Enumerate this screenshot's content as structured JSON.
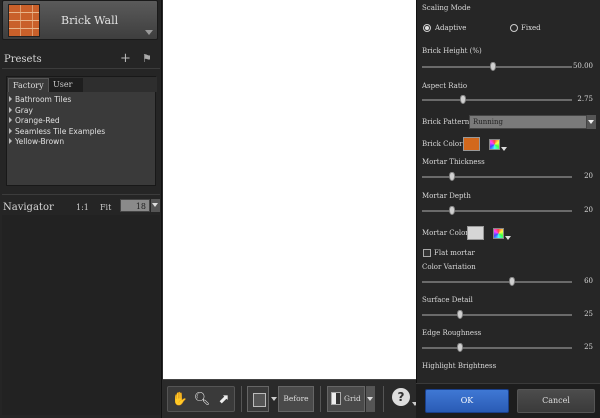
{
  "filter": {
    "name": "Brick Wall"
  },
  "presets": {
    "title": "Presets",
    "tabs": [
      "Factory",
      "User"
    ],
    "items": [
      "Bathroom Tiles",
      "Gray",
      "Orange-Red",
      "Seamless Tile Examples",
      "Yellow-Brown"
    ]
  },
  "navigator": {
    "title": "Navigator",
    "one_to_one": "1:1",
    "fit": "Fit",
    "zoom": "18"
  },
  "toolbar": {
    "before_label": "Before",
    "grid_label": "Grid"
  },
  "settings": {
    "scaling_mode": {
      "label": "Scaling Mode",
      "options": [
        "Adaptive",
        "Fixed"
      ],
      "selected": "Adaptive"
    },
    "brick_height": {
      "label": "Brick Height (%)",
      "value": "50.00",
      "fraction": 0.47
    },
    "aspect_ratio": {
      "label": "Aspect Ratio",
      "value": "2.75",
      "fraction": 0.27
    },
    "brick_pattern": {
      "label": "Brick Pattern",
      "value": "Running"
    },
    "brick_color": {
      "label": "Brick Color",
      "color": "#d2681c"
    },
    "mortar_thickness": {
      "label": "Mortar Thickness",
      "value": "20",
      "fraction": 0.2
    },
    "mortar_depth": {
      "label": "Mortar Depth",
      "value": "20",
      "fraction": 0.2
    },
    "mortar_color": {
      "label": "Mortar Color",
      "color": "#d6d6d6"
    },
    "flat_mortar": {
      "label": "Flat mortar",
      "checked": false
    },
    "color_variation": {
      "label": "Color Variation",
      "value": "60",
      "fraction": 0.6
    },
    "surface_detail": {
      "label": "Surface Detail",
      "value": "25",
      "fraction": 0.25
    },
    "edge_roughness": {
      "label": "Edge Roughness",
      "value": "25",
      "fraction": 0.25
    },
    "highlight_brightness": {
      "label": "Highlight Brightness"
    }
  },
  "footer": {
    "ok_label": "OK",
    "cancel_label": "Cancel"
  }
}
